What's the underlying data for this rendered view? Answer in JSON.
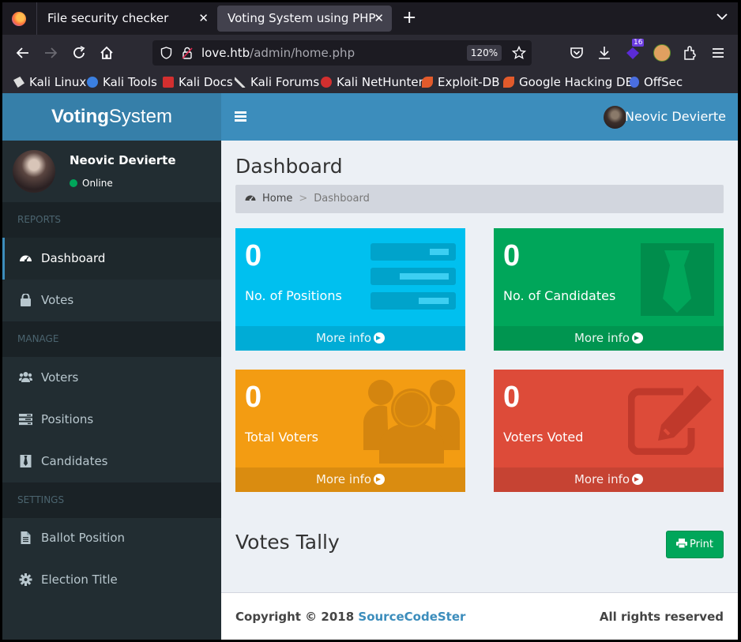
{
  "browser": {
    "tabs": [
      {
        "title": "File security checker",
        "close": "✕"
      },
      {
        "title": "Voting System using PHP",
        "close": "✕"
      }
    ],
    "new_tab": "+",
    "url_host": "love.htb",
    "url_path": "/admin/home.php",
    "zoom": "120%",
    "extension_badge": "16",
    "bookmarks": [
      {
        "label": "Kali Linux",
        "icon": "kali-dragon-icon",
        "color": "#1a6ac4"
      },
      {
        "label": "Kali Tools",
        "icon": "kali-tools-icon",
        "color": "#3b7fe0"
      },
      {
        "label": "Kali Docs",
        "icon": "kali-docs-icon",
        "color": "#d32f2f"
      },
      {
        "label": "Kali Forums",
        "icon": "kali-forums-icon",
        "color": "#ddd"
      },
      {
        "label": "Kali NetHunter",
        "icon": "nethunter-icon",
        "color": "#d32f2f"
      },
      {
        "label": "Exploit-DB",
        "icon": "exploit-db-icon",
        "color": "#e25a2b"
      },
      {
        "label": "Google Hacking DB",
        "icon": "ghdb-icon",
        "color": "#e25a2b"
      },
      {
        "label": "OffSec",
        "icon": "offsec-icon",
        "color": "#4a6ee0"
      }
    ]
  },
  "app": {
    "logo_bold": "Voting",
    "logo_light": "System",
    "user_name": "Neovic Devierte",
    "status": "Online"
  },
  "sidebar": {
    "sections": [
      {
        "header": "REPORTS",
        "items": [
          {
            "label": "Dashboard",
            "icon": "dashboard-icon",
            "active": true
          },
          {
            "label": "Votes",
            "icon": "lock-icon"
          }
        ]
      },
      {
        "header": "MANAGE",
        "items": [
          {
            "label": "Voters",
            "icon": "users-icon"
          },
          {
            "label": "Positions",
            "icon": "tasks-icon"
          },
          {
            "label": "Candidates",
            "icon": "tie-icon"
          }
        ]
      },
      {
        "header": "SETTINGS",
        "items": [
          {
            "label": "Ballot Position",
            "icon": "file-icon"
          },
          {
            "label": "Election Title",
            "icon": "cog-icon"
          }
        ]
      }
    ]
  },
  "content": {
    "title": "Dashboard",
    "breadcrumb": {
      "home": "Home",
      "separator": ">",
      "current": "Dashboard"
    },
    "boxes": [
      {
        "value": "0",
        "label": "No. of Positions",
        "footer": "More info",
        "color": "#00c0ef",
        "icon": "tasks-icon"
      },
      {
        "value": "0",
        "label": "No. of Candidates",
        "footer": "More info",
        "color": "#00a65a",
        "icon": "tie-icon"
      },
      {
        "value": "0",
        "label": "Total Voters",
        "footer": "More info",
        "color": "#f39c12",
        "icon": "users-icon"
      },
      {
        "value": "0",
        "label": "Voters Voted",
        "footer": "More info",
        "color": "#dd4b39",
        "icon": "edit-icon"
      }
    ],
    "tally_title": "Votes Tally",
    "print_label": "Print"
  },
  "footer": {
    "copyright": "Copyright © 2018",
    "brand": "SourceCodeSter",
    "rights": "All rights reserved"
  }
}
